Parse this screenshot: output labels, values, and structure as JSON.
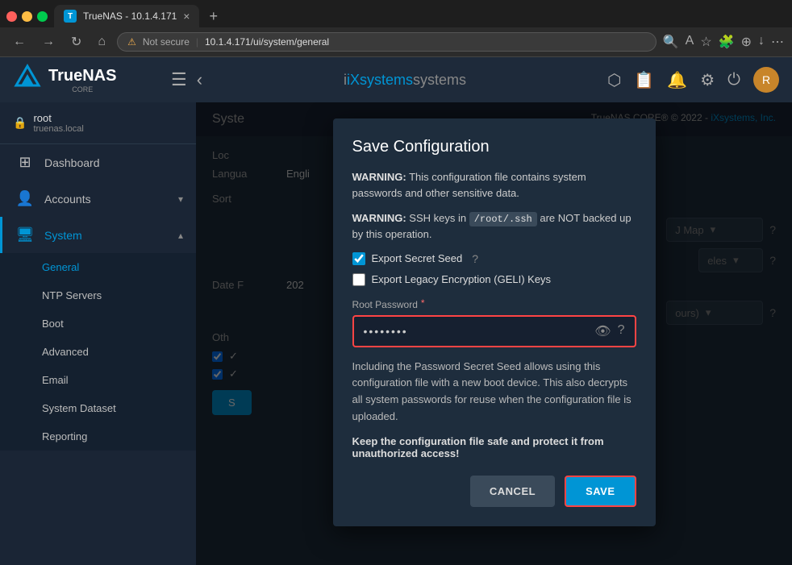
{
  "browser": {
    "tab_title": "TrueNAS - 10.1.4.171",
    "url": "10.1.4.171/ui/system/general",
    "security_warning": "Not secure",
    "new_tab": "+",
    "favicon": "T"
  },
  "topbar": {
    "logo": "TrueNAS",
    "logo_sub": "CORE",
    "menu_icon": "☰",
    "back_icon": "‹",
    "brand": "iXsystems",
    "copyright": "TrueNAS CORE® © 2022 - iXsystems, Inc."
  },
  "sidebar": {
    "user": {
      "name": "root",
      "host": "truenas.local"
    },
    "items": [
      {
        "label": "Dashboard",
        "icon": "⊞"
      },
      {
        "label": "Accounts",
        "icon": "👤",
        "has_arrow": true
      },
      {
        "label": "System",
        "icon": "🖥",
        "active": true,
        "has_arrow": true,
        "arrow_up": true
      }
    ],
    "sub_items": [
      {
        "label": "General",
        "active": true
      },
      {
        "label": "NTP Servers"
      },
      {
        "label": "Boot"
      },
      {
        "label": "Advanced"
      },
      {
        "label": "Email"
      },
      {
        "label": "System Dataset"
      },
      {
        "label": "Reporting"
      }
    ]
  },
  "content": {
    "header": "Syste",
    "section_labels": {
      "loc": "Loc",
      "language_label": "Langua",
      "language_value": "Engli",
      "sort_label": "Sort",
      "date_format_label": "Date F",
      "date_value": "202",
      "other_label": "Oth"
    }
  },
  "dialog": {
    "title": "Save Configuration",
    "warning1_bold": "WARNING:",
    "warning1_text": "This configuration file contains system passwords and other sensitive data.",
    "warning2_bold": "WARNING:",
    "warning2_text": "SSH keys in",
    "ssh_path": "/root/.ssh",
    "warning2_suffix": "are NOT backed up by this operation.",
    "checkbox_export_seed_label": "Export Secret Seed",
    "checkbox_export_seed_checked": true,
    "checkbox_legacy_label": "Export Legacy Encryption (GELI) Keys",
    "checkbox_legacy_checked": false,
    "password_label": "Root Password",
    "password_required": "*",
    "password_value": "••••••••",
    "info_text": "Including the Password Secret Seed allows using this configuration file with a new boot device. This also decrypts all system passwords for reuse when the configuration file is uploaded.",
    "warning_bold": "Keep the configuration file safe and protect it from unauthorized access!",
    "cancel_label": "CANCEL",
    "save_label": "SAVE"
  }
}
